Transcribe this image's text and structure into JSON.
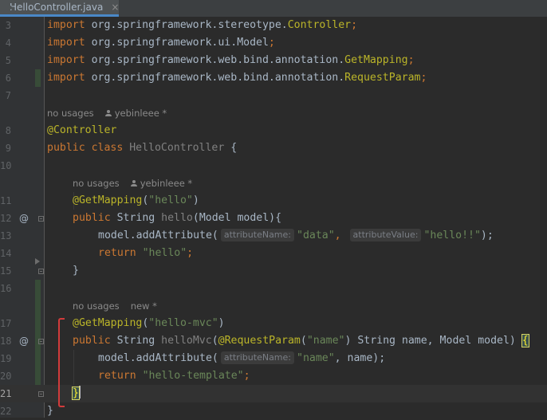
{
  "tab": {
    "title": "HelloController.java",
    "close": "×",
    "icon": "java-class-icon"
  },
  "colors": {
    "keyword": "#cc7832",
    "annotation": "#bbb529",
    "string": "#6a8759",
    "text": "#a9b7c6",
    "marker": "#d23b3b"
  },
  "lines": {
    "l3": {
      "num": "3",
      "kw": "import",
      "pkg": " org.springframework.stereotype.",
      "cls": "Controller",
      "semi": ";"
    },
    "l4": {
      "num": "4",
      "kw": "import",
      "pkg": " org.springframework.ui.Model",
      "semi": ";"
    },
    "l5": {
      "num": "5",
      "kw": "import",
      "pkg": " org.springframework.web.bind.annotation.",
      "cls": "GetMapping",
      "semi": ";"
    },
    "l6": {
      "num": "6",
      "kw": "import",
      "pkg": " org.springframework.web.bind.annotation.",
      "cls": "RequestParam",
      "semi": ";"
    },
    "l7": {
      "num": "7"
    },
    "lens1": {
      "usages": "no usages",
      "author": "yebinleee *"
    },
    "l8": {
      "num": "8",
      "ann": "@Controller"
    },
    "l9": {
      "num": "9",
      "kw": "public class",
      "name": " HelloController ",
      "brace": "{"
    },
    "l10": {
      "num": "10"
    },
    "lens2": {
      "usages": "no usages",
      "author": "yebinleee *"
    },
    "l11": {
      "num": "11",
      "ann": "@GetMapping",
      "open": "(",
      "str": "\"hello\"",
      "close": ")"
    },
    "l12": {
      "num": "12",
      "gutter": "@",
      "kw": "public",
      "type": " String ",
      "name": "hello",
      "rest": "(Model model){"
    },
    "l13": {
      "num": "13",
      "recv": "model.addAttribute(",
      "hint1": "attributeName:",
      "str1": "\"data\"",
      "comma": ", ",
      "hint2": "attributeValue:",
      "str2": "\"hello!!\"",
      "end": ");"
    },
    "l14": {
      "num": "14",
      "kw": "return",
      "str": " \"hello\"",
      "semi": ";"
    },
    "l15": {
      "num": "15",
      "brace": "}"
    },
    "l16": {
      "num": "16"
    },
    "lens3": {
      "usages": "no usages",
      "author": "new *"
    },
    "l17": {
      "num": "17",
      "ann": "@GetMapping",
      "open": "(",
      "str": "\"hello-mvc\"",
      "close": ")"
    },
    "l18": {
      "num": "18",
      "gutter": "@",
      "kw": "public",
      "type": " String ",
      "name": "helloMvc",
      "open": "(",
      "ann": "@RequestParam",
      "p1": "(",
      "str": "\"name\"",
      "p2": ") String name, Model model) ",
      "brace": "{"
    },
    "l19": {
      "num": "19",
      "recv": "model.addAttribute(",
      "hint1": "attributeName:",
      "str1": "\"name\"",
      "end": ", name);"
    },
    "l20": {
      "num": "20",
      "kw": "return",
      "str": " \"hello-template\"",
      "semi": ";"
    },
    "l21": {
      "num": "21",
      "brace": "}"
    },
    "l22": {
      "num": "22",
      "brace": "}"
    }
  }
}
